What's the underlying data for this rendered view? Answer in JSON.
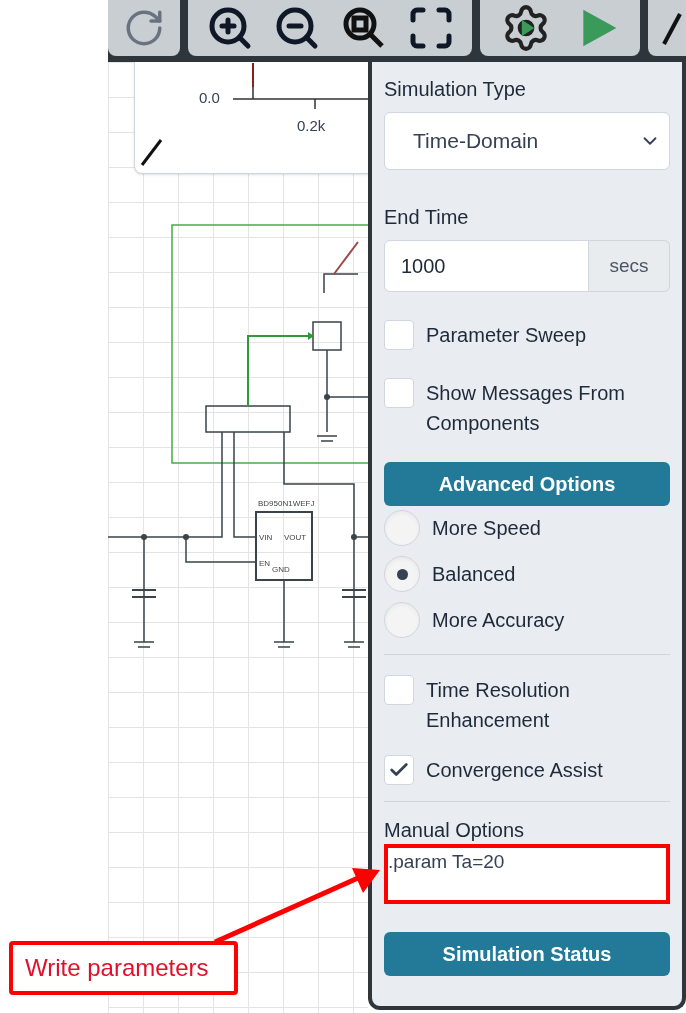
{
  "plot": {
    "y_ticks": [
      "0.0"
    ],
    "x_ticks": [
      "0.2k"
    ]
  },
  "schematic": {
    "part_name": "BD950N1WEFJ",
    "pins": [
      "VIN",
      "VOUT",
      "EN",
      "GND"
    ]
  },
  "panel": {
    "simulation_type": {
      "label": "Simulation Type",
      "value": "Time-Domain"
    },
    "end_time": {
      "label": "End Time",
      "value": "1000",
      "unit": "secs"
    },
    "options": [
      {
        "label": "Parameter Sweep",
        "checked": false
      },
      {
        "label": "Show Messages From Components",
        "checked": false
      }
    ],
    "advanced_button": "Advanced Options",
    "modes": [
      {
        "label": "More Speed",
        "selected": false
      },
      {
        "label": "Balanced",
        "selected": true
      },
      {
        "label": "More Accuracy",
        "selected": false
      }
    ],
    "advanced_options": [
      {
        "label": "Time Resolution Enhancement",
        "checked": false
      },
      {
        "label": "Convergence Assist",
        "checked": true
      }
    ],
    "manual_options": {
      "label": "Manual Options",
      "value": ".param Ta=20"
    },
    "status_button": "Simulation Status"
  },
  "annotation": {
    "text": "Write parameters"
  }
}
